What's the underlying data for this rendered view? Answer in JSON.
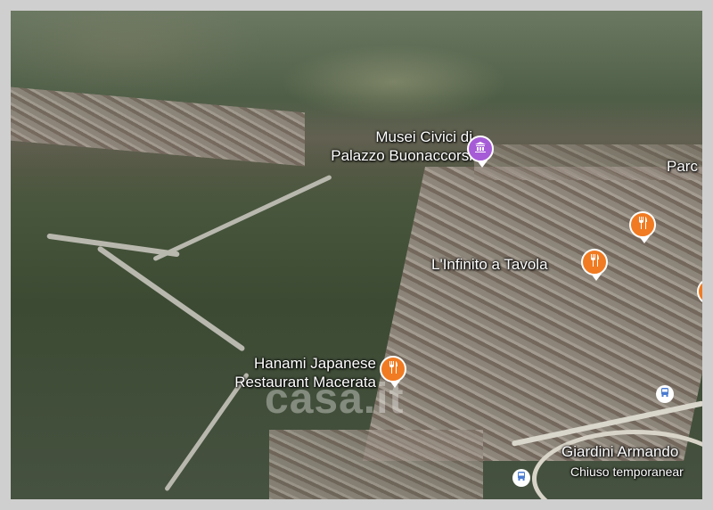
{
  "map": {
    "places": {
      "museum_line1": "Musei Civici di",
      "museum_line2": "Palazzo Buonaccorsi",
      "parco": "Parc",
      "infinito": "L'Infinito a Tavola",
      "hanami_line1": "Hanami Japanese",
      "hanami_line2": "Restaurant Macerata",
      "giardini": "Giardini Armando",
      "giardini_status": "Chiuso temporanear"
    },
    "icons": {
      "museum": "museum-icon",
      "restaurant": "restaurant-icon",
      "bus": "bus-stop-icon"
    },
    "colors": {
      "restaurant_pin": "#f07b22",
      "museum_pin": "#a65cd6",
      "frame": "#cfcfcf"
    },
    "watermark": "casa.it"
  }
}
